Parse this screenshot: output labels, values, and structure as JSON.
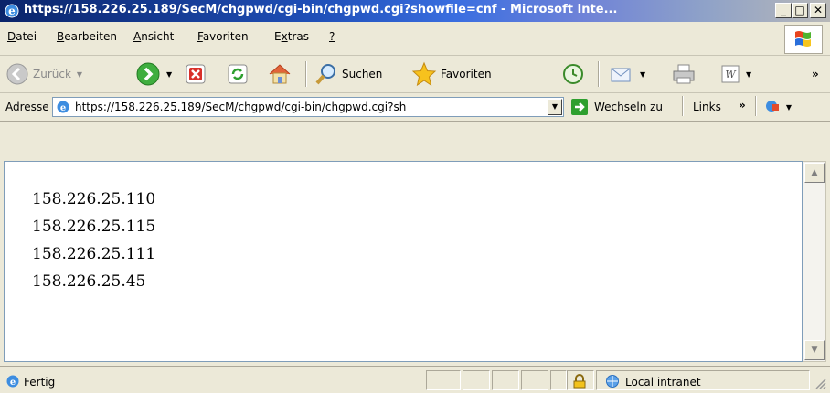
{
  "window": {
    "title": "https://158.226.25.189/SecM/chgpwd/cgi-bin/chgpwd.cgi?showfile=cnf - Microsoft Inte...",
    "controls": {
      "minimize": "_",
      "maximize": "□",
      "close": "✕"
    }
  },
  "menu": [
    {
      "key": "D",
      "rest": "atei"
    },
    {
      "key": "B",
      "rest": "earbeiten"
    },
    {
      "key": "A",
      "rest": "nsicht"
    },
    {
      "key": "F",
      "rest": "avoriten"
    },
    {
      "pre": "E",
      "key": "x",
      "rest": "tras"
    },
    {
      "key": "?",
      "rest": ""
    }
  ],
  "menu_labels": {
    "datei_k": "D",
    "datei_r": "atei",
    "bearb_k": "B",
    "bearb_r": "earbeiten",
    "ansicht_k": "A",
    "ansicht_r": "nsicht",
    "fav_k": "F",
    "fav_r": "avoriten",
    "extras_p": "E",
    "extras_k": "x",
    "extras_r": "tras",
    "help_k": "?"
  },
  "toolbar": {
    "back_label": "Zurück",
    "search_label": "Suchen",
    "favorites_label": "Favoriten"
  },
  "address": {
    "label_pre": "Adre",
    "label_key": "s",
    "label_post": "se",
    "url": "https://158.226.25.189/SecM/chgpwd/cgi-bin/chgpwd.cgi?sh",
    "go_label": "Wechseln zu",
    "links_label": "Links",
    "links_chevron": "»"
  },
  "content": {
    "lines": [
      "158.226.25.110",
      "158.226.25.115",
      "158.226.25.111",
      "158.226.25.45"
    ]
  },
  "status": {
    "text": "Fertig",
    "zone": "Local intranet"
  },
  "colors": {
    "titlebar_start": "#0a246a",
    "chrome": "#ece9d8",
    "go_green": "#2e9f2e"
  },
  "icons": [
    "ie-icon",
    "back-icon",
    "forward-icon",
    "stop-icon",
    "refresh-icon",
    "home-icon",
    "search-icon",
    "favorites-star-icon",
    "history-icon",
    "mail-icon",
    "print-icon",
    "word-icon",
    "go-arrow-icon",
    "lock-icon",
    "intranet-icon",
    "windows-logo-icon"
  ]
}
